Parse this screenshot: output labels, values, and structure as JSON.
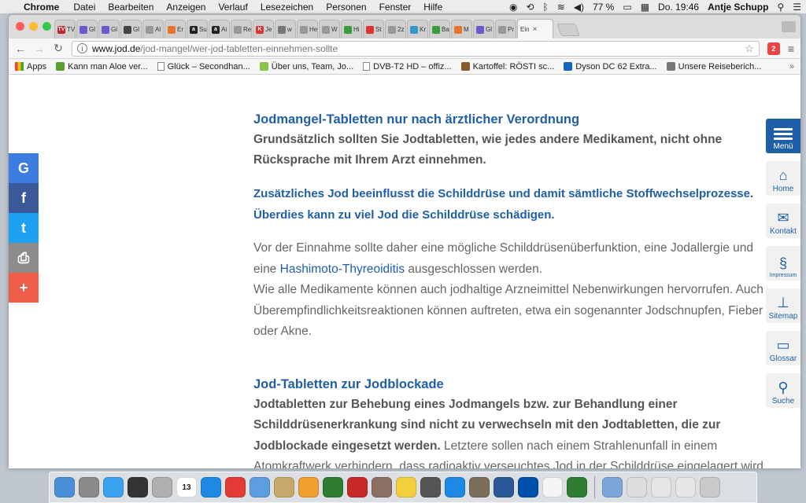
{
  "menubar": {
    "app": "Chrome",
    "items": [
      "Datei",
      "Bearbeiten",
      "Anzeigen",
      "Verlauf",
      "Lesezeichen",
      "Personen",
      "Fenster",
      "Hilfe"
    ],
    "battery": "77 %",
    "clock": "Do. 19:46",
    "user": "Antje Schupp"
  },
  "tabs": [
    {
      "label": "TV",
      "color": "#c1272d",
      "icon": "TV"
    },
    {
      "label": "Gl",
      "color": "#6a5acd",
      "icon": ""
    },
    {
      "label": "Gl",
      "color": "#6a5acd",
      "icon": ""
    },
    {
      "label": "Gl",
      "color": "#444",
      "icon": ""
    },
    {
      "label": "Al",
      "color": "#999",
      "icon": ""
    },
    {
      "label": "Er",
      "color": "#e8742a",
      "icon": ""
    },
    {
      "label": "Su",
      "color": "#222",
      "icon": "a"
    },
    {
      "label": "Ai",
      "color": "#222",
      "icon": "a"
    },
    {
      "label": "Re",
      "color": "#999",
      "icon": ""
    },
    {
      "label": "Je",
      "color": "#d33",
      "icon": "K"
    },
    {
      "label": "w",
      "color": "#777",
      "icon": ""
    },
    {
      "label": "He",
      "color": "#999",
      "icon": ""
    },
    {
      "label": "W",
      "color": "#999",
      "icon": ""
    },
    {
      "label": "Hi",
      "color": "#3b9c3b",
      "icon": ""
    },
    {
      "label": "St",
      "color": "#d33",
      "icon": ""
    },
    {
      "label": "2z",
      "color": "#999",
      "icon": ""
    },
    {
      "label": "Kr",
      "color": "#39c",
      "icon": ""
    },
    {
      "label": "Ba",
      "color": "#3b9c3b",
      "icon": ""
    },
    {
      "label": "M",
      "color": "#e8742a",
      "icon": ""
    },
    {
      "label": "Gl",
      "color": "#6a5acd",
      "icon": ""
    },
    {
      "label": "Pr",
      "color": "#999",
      "icon": ""
    }
  ],
  "active_tab": {
    "label": "Ein"
  },
  "toolbar": {
    "url_domain": "www.jod.de",
    "url_path": "/jod-mangel/wer-jod-tabletten-einnehmen-sollte",
    "ext_label": "2"
  },
  "bookmarks": [
    {
      "label": "Apps",
      "icon": "apps",
      "color": "#e44"
    },
    {
      "label": "Kann man Aloe ver...",
      "icon": "leaf",
      "color": "#5a9e2f"
    },
    {
      "label": "Glück – Secondhan...",
      "icon": "doc",
      "color": "#fff"
    },
    {
      "label": "Über uns, Team, Jo...",
      "icon": "sq",
      "color": "#8bc34a"
    },
    {
      "label": "DVB-T2 HD – offiz...",
      "icon": "doc",
      "color": "#fff"
    },
    {
      "label": "Kartoffel: RÖSTI sc...",
      "icon": "sq",
      "color": "#8b5a2b"
    },
    {
      "label": "Dyson DC 62 Extra...",
      "icon": "sq",
      "color": "#1565c0"
    },
    {
      "label": "Unsere Reiseberich...",
      "icon": "sq",
      "color": "#777"
    }
  ],
  "share": [
    {
      "glyph": "G",
      "color": "#3b7de0",
      "name": "google"
    },
    {
      "glyph": "f",
      "color": "#3b5998",
      "name": "facebook"
    },
    {
      "glyph": "t",
      "color": "#1da1f2",
      "name": "twitter"
    },
    {
      "glyph": "⎙",
      "color": "#8c8c8c",
      "name": "print"
    },
    {
      "glyph": "+",
      "color": "#ef5d4b",
      "name": "more"
    }
  ],
  "sidenav": [
    {
      "label": "Menü",
      "name": "menu"
    },
    {
      "label": "Home",
      "name": "home",
      "glyph": "⌂"
    },
    {
      "label": "Kontakt",
      "name": "kontakt",
      "glyph": "✉"
    },
    {
      "label": "Impressum",
      "name": "impressum",
      "glyph": "§"
    },
    {
      "label": "Sitemap",
      "name": "sitemap",
      "glyph": "⊥"
    },
    {
      "label": "Glossar",
      "name": "glossar",
      "glyph": "▭"
    },
    {
      "label": "Suche",
      "name": "suche",
      "glyph": "⚲"
    }
  ],
  "content": {
    "h1": "Jodmangel-Tabletten nur nach ärztlicher Verordnung",
    "p1": "Grundsätzlich sollten Sie Jodtabletten, wie jedes andere Medikament, nicht ohne Rücksprache mit Ihrem Arzt einnehmen.",
    "lead1": "Zusätzliches Jod beeinflusst die Schilddrüse und damit sämtliche Stoffwechselprozesse.",
    "lead2": "Überdies kann zu viel Jod die Schilddrüse schädigen.",
    "p2_a": "Vor der Einnahme sollte daher eine mögliche Schilddrüsenüberfunktion, eine Jodallergie und eine",
    "p2_link": "Hashimoto-Thyreoiditis",
    "p2_b": " ausgeschlossen werden.",
    "p3": "Wie alle Medikamente können auch jodhaltige Arzneimittel Nebenwirkungen hervorrufen. Auch Überempfindlichkeitsreaktionen können auftreten, etwa ein sogenannter Jodschnupfen, Fieber oder Akne.",
    "h2": "Jod-Tabletten zur Jodblockade",
    "p4_bold": "Jodtabletten zur Behebung eines Jodmangels bzw. zur Behandlung einer Schilddrüsenerkrankung sind nicht zu verwechseln mit den Jodtabletten, die zur Jodblockade eingesetzt werden.",
    "p4_rest": " Letztere sollen nach einem Strahlenunfall in einem Atomkraftwerk verhindern, dass radioaktiv verseuchtes Jod in der Schilddrüse eingelagert wird. Diese Präparate werden von"
  },
  "dock": [
    {
      "name": "finder",
      "color": "#4a90d9"
    },
    {
      "name": "launchpad",
      "color": "#8a8a8a"
    },
    {
      "name": "messages",
      "color": "#3ba4f0"
    },
    {
      "name": "dashboard",
      "color": "#333"
    },
    {
      "name": "calculator",
      "color": "#b0b0b0"
    },
    {
      "name": "calendar",
      "color": "#fff",
      "label": "13"
    },
    {
      "name": "safari",
      "color": "#1e88e5"
    },
    {
      "name": "chrome",
      "color": "#e53935"
    },
    {
      "name": "mail",
      "color": "#5c9ee0"
    },
    {
      "name": "contacts",
      "color": "#c8a86a"
    },
    {
      "name": "photos",
      "color": "#f0a030"
    },
    {
      "name": "iphoto",
      "color": "#2e7d32"
    },
    {
      "name": "photo-booth",
      "color": "#c62828"
    },
    {
      "name": "preview",
      "color": "#8d6e63"
    },
    {
      "name": "notes",
      "color": "#f4d03f"
    },
    {
      "name": "quicktime",
      "color": "#555"
    },
    {
      "name": "app-store",
      "color": "#1e88e5"
    },
    {
      "name": "gimp",
      "color": "#7d6e5a"
    },
    {
      "name": "word",
      "color": "#2b5797"
    },
    {
      "name": "lidl",
      "color": "#0050aa"
    },
    {
      "name": "cards",
      "color": "#f5f5f5"
    },
    {
      "name": "excel",
      "color": "#2e7d32"
    },
    {
      "name": "folder",
      "color": "#7aa7d8"
    },
    {
      "name": "downloads",
      "color": "#ddd"
    },
    {
      "name": "docs",
      "color": "#e6e6e6"
    },
    {
      "name": "stack",
      "color": "#e6e6e6"
    },
    {
      "name": "trash",
      "color": "#c9c9c9"
    }
  ]
}
